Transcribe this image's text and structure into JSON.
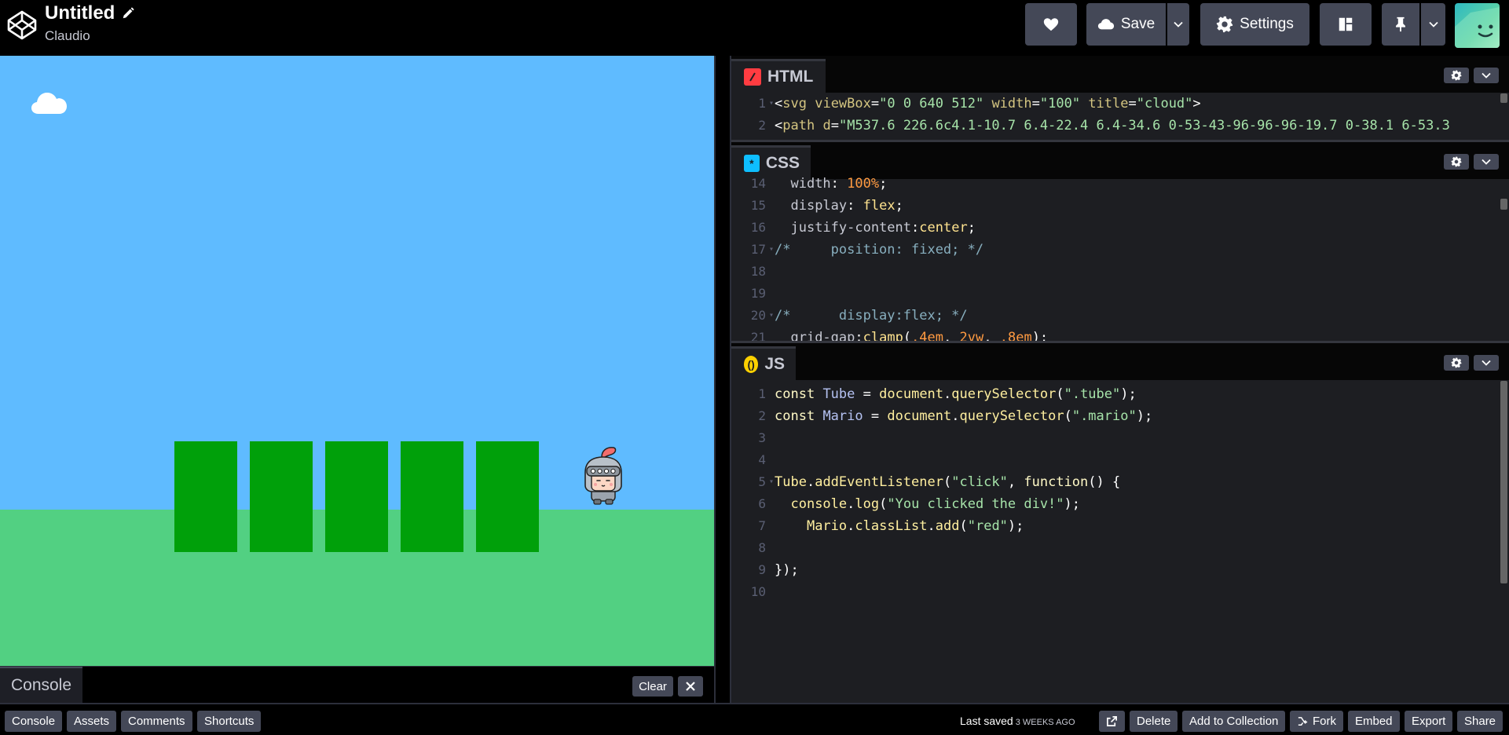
{
  "header": {
    "title": "Untitled",
    "author": "Claudio",
    "save_label": "Save",
    "settings_label": "Settings"
  },
  "console": {
    "tab_label": "Console",
    "clear_label": "Clear"
  },
  "editors": {
    "html": {
      "label": "HTML",
      "icon_color": "#ff3c41",
      "lines": [
        {
          "n": "1",
          "html": "<span class='c-punc'>&lt;</span><span class='c-tag'>svg</span> <span class='c-attr'>viewBox</span><span class='c-punc'>=</span><span class='c-str'>\"0 0 640 512\"</span> <span class='c-attr'>width</span><span class='c-punc'>=</span><span class='c-str'>\"100\"</span> <span class='c-attr'>title</span><span class='c-punc'>=</span><span class='c-str'>\"cloud\"</span><span class='c-punc'>&gt;</span>",
          "fold": true
        },
        {
          "n": "2",
          "html": "<span class='c-punc'>&lt;</span><span class='c-tag'>path</span> <span class='c-attr'>d</span><span class='c-punc'>=</span><span class='c-str'>\"M537.6 226.6c4.1-10.7 6.4-22.4 6.4-34.6 0-53-43-96-96-96-19.7 0-38.1 6-53.3</span>",
          "fold": false
        }
      ]
    },
    "css": {
      "label": "CSS",
      "icon_color": "#0ebeff",
      "lines": [
        {
          "n": "14",
          "html": "  <span class='c-prop'>width</span><span class='c-punc'>:</span> <span class='c-num'>100%</span><span class='c-punc'>;</span>",
          "fold": false
        },
        {
          "n": "15",
          "html": "  <span class='c-prop'>display</span><span class='c-punc'>:</span> <span class='c-val'>flex</span><span class='c-punc'>;</span>",
          "fold": false
        },
        {
          "n": "16",
          "html": "  <span class='c-prop'>justify-content</span><span class='c-punc'>:</span><span class='c-val'>center</span><span class='c-punc'>;</span>",
          "fold": false
        },
        {
          "n": "17",
          "html": "<span class='c-cmt'>/*     position: fixed; */</span>",
          "fold": true
        },
        {
          "n": "18",
          "html": "",
          "fold": false
        },
        {
          "n": "19",
          "html": "",
          "fold": false
        },
        {
          "n": "20",
          "html": "<span class='c-cmt'>/*      display:flex; */</span>",
          "fold": true
        },
        {
          "n": "21",
          "html": "  <span class='c-prop'>grid-gap</span><span class='c-punc'>:</span><span class='c-val'>clamp</span><span class='c-punc'>(</span><span class='c-num'>.4em</span><span class='c-punc'>,</span> <span class='c-num'>2vw</span><span class='c-punc'>,</span> <span class='c-num'>.8em</span><span class='c-punc'>);</span>",
          "fold": false
        }
      ]
    },
    "js": {
      "label": "JS",
      "icon_color": "#fcd000",
      "lines": [
        {
          "n": "1",
          "html": "<span class='c-kw'>const</span> <span class='c-var'>Tube</span> <span class='c-punc'>=</span> <span class='c-fn'>document</span><span class='c-punc'>.</span><span class='c-fn'>querySelector</span><span class='c-punc'>(</span><span class='c-str'>\".tube\"</span><span class='c-punc'>);</span>",
          "fold": false
        },
        {
          "n": "2",
          "html": "<span class='c-kw'>const</span> <span class='c-var'>Mario</span> <span class='c-punc'>=</span> <span class='c-fn'>document</span><span class='c-punc'>.</span><span class='c-fn'>querySelector</span><span class='c-punc'>(</span><span class='c-str'>\".mario\"</span><span class='c-punc'>);</span>",
          "fold": false
        },
        {
          "n": "3",
          "html": "",
          "fold": false
        },
        {
          "n": "4",
          "html": "",
          "fold": false
        },
        {
          "n": "5",
          "html": "<span class='c-fn'>Tube</span><span class='c-punc'>.</span><span class='c-fn'>addEventListener</span><span class='c-punc'>(</span><span class='c-str'>\"click\"</span><span class='c-punc'>,</span> <span class='c-kw'>function</span><span class='c-punc'>() {</span>",
          "fold": true
        },
        {
          "n": "6",
          "html": "  <span class='c-fn'>console</span><span class='c-punc'>.</span><span class='c-fn'>log</span><span class='c-punc'>(</span><span class='c-str'>\"You clicked the div!\"</span><span class='c-punc'>);</span>",
          "fold": false
        },
        {
          "n": "7",
          "html": "    <span class='c-fn'>Mario</span><span class='c-punc'>.</span><span class='c-fn'>classList</span><span class='c-punc'>.</span><span class='c-fn'>add</span><span class='c-punc'>(</span><span class='c-str'>\"red\"</span><span class='c-punc'>);</span>",
          "fold": false
        },
        {
          "n": "8",
          "html": "",
          "fold": false
        },
        {
          "n": "9",
          "html": "<span class='c-punc'>});</span>",
          "fold": false
        },
        {
          "n": "10",
          "html": "",
          "fold": false
        }
      ]
    }
  },
  "footer": {
    "buttons": [
      "Console",
      "Assets",
      "Comments",
      "Shortcuts"
    ],
    "last_saved_label": "Last saved",
    "last_saved_ago": "3 weeks ago",
    "delete_label": "Delete",
    "add_collection_label": "Add to Collection",
    "fork_label": "Fork",
    "embed_label": "Embed",
    "export_label": "Export",
    "share_label": "Share"
  },
  "preview": {
    "sky_color": "#5fbbff",
    "ground_color": "#52d082",
    "tube_color": "#00a00a",
    "tube_count": 5
  }
}
